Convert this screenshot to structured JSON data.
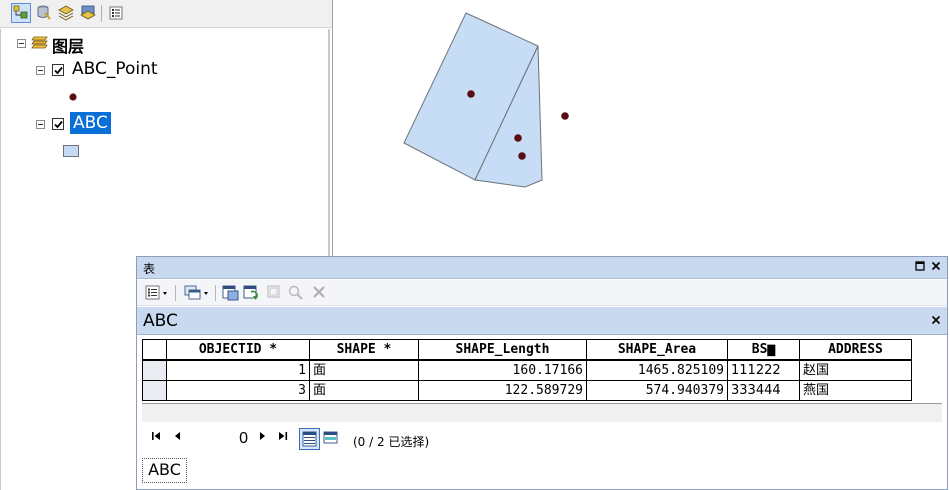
{
  "toc": {
    "root_label": "图层",
    "layers": [
      {
        "name": "ABC_Point",
        "checked": true,
        "selected": false
      },
      {
        "name": "ABC",
        "checked": true,
        "selected": true
      }
    ],
    "colors": {
      "point_symbol": "#5a0d12",
      "polygon_fill": "#c5daf3",
      "selection_highlight": "#0a6fd6"
    }
  },
  "map": {
    "colors": {
      "polygon_fill": "#c7dcf5",
      "polygon_stroke": "#6c7278",
      "point_fill": "#5a0d12"
    }
  },
  "table_window": {
    "title": "表",
    "tab_label": "ABC",
    "columns": [
      "OBJECTID *",
      "SHAPE *",
      "SHAPE_Length",
      "SHAPE_Area",
      "BS▆",
      "ADDRESS"
    ],
    "rows": [
      {
        "objectid": "1",
        "shape": "面",
        "shape_length": "160.17166",
        "shape_area": "1465.825109",
        "bsm": "111222",
        "address": "赵国"
      },
      {
        "objectid": "3",
        "shape": "面",
        "shape_length": "122.589729",
        "shape_area": "574.940379",
        "bsm": "333444",
        "address": "燕国"
      }
    ],
    "navigation": {
      "current_record": "0",
      "selection_status": "(0 / 2 已选择)"
    },
    "bottom_tab": "ABC"
  }
}
